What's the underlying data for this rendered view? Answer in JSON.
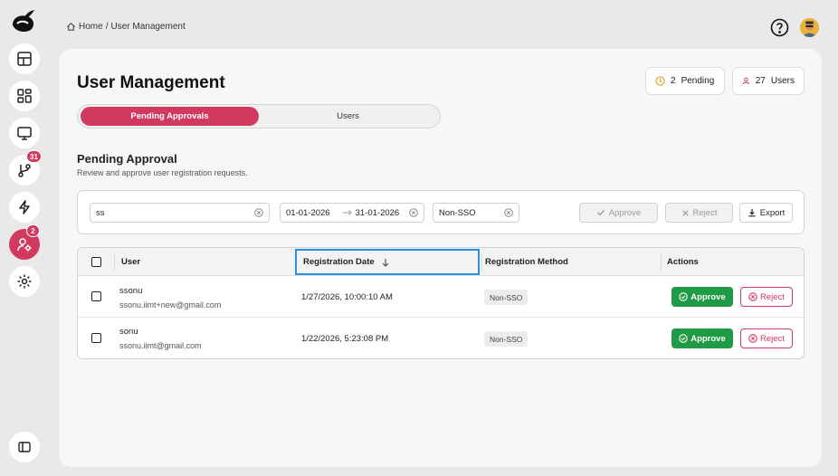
{
  "breadcrumb": {
    "home": "Home",
    "separator": "/",
    "current": "User Management"
  },
  "sidebar": {
    "items": [
      {
        "name": "dashboard",
        "icon": "layout-icon"
      },
      {
        "name": "apps",
        "icon": "grid-icon"
      },
      {
        "name": "monitor",
        "icon": "monitor-icon"
      },
      {
        "name": "workflows",
        "icon": "branch-icon",
        "badge": "31"
      },
      {
        "name": "automation",
        "icon": "lightning-icon"
      },
      {
        "name": "user-management",
        "icon": "user-gear-icon",
        "badge": "2",
        "active": true
      },
      {
        "name": "settings",
        "icon": "gear-icon"
      }
    ],
    "collapse_icon": "sidebar-toggle-icon"
  },
  "page": {
    "title": "User Management"
  },
  "stats": {
    "pending": {
      "count": "2",
      "label": "Pending"
    },
    "users": {
      "count": "27",
      "label": "Users"
    }
  },
  "tabs": [
    {
      "label": "Pending Approvals",
      "active": true
    },
    {
      "label": "Users",
      "active": false
    }
  ],
  "section": {
    "title": "Pending Approval",
    "subtitle": "Review and approve user registration requests."
  },
  "filters": {
    "search_value": "ss",
    "date_start": "01-01-2026",
    "date_end": "31-01-2026",
    "method": "Non-SSO",
    "approve_label": "Approve",
    "reject_label": "Reject",
    "export_label": "Export"
  },
  "table": {
    "headers": [
      "User",
      "Registration Date",
      "Registration Method",
      "Actions"
    ],
    "sort_column": "Registration Date",
    "sort_direction": "descending",
    "rows": [
      {
        "name": "ssonu",
        "email": "ssonu.iimt+new@gmail.com",
        "date": "1/27/2026, 10:00:10 AM",
        "method": "Non-SSO",
        "approve": "Approve",
        "reject": "Reject"
      },
      {
        "name": "sonu",
        "email": "ssonu.iimt@gmail.com",
        "date": "1/22/2026, 5:23:08 PM",
        "method": "Non-SSO",
        "approve": "Approve",
        "reject": "Reject"
      }
    ]
  },
  "colors": {
    "accent": "#d1395f",
    "approve": "#1f9a45",
    "focus": "#2e8fdf"
  }
}
